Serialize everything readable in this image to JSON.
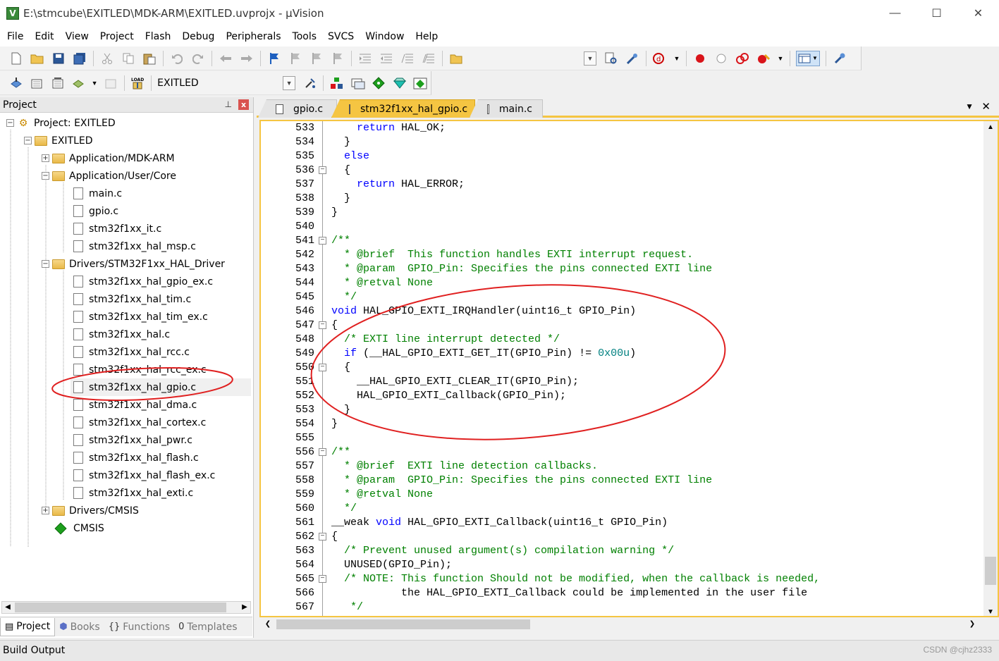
{
  "window": {
    "title": "E:\\stmcube\\EXITLED\\MDK-ARM\\EXITLED.uvprojx - µVision",
    "app_icon_letter": "V",
    "minimize": "—",
    "maximize": "☐",
    "close": "✕"
  },
  "menu": [
    "File",
    "Edit",
    "View",
    "Project",
    "Flash",
    "Debug",
    "Peripherals",
    "Tools",
    "SVCS",
    "Window",
    "Help"
  ],
  "toolbar2": {
    "target": "EXITLED"
  },
  "project_panel": {
    "title": "Project",
    "pin": "📌",
    "close": "x",
    "tree": {
      "root": "Project: EXITLED",
      "target": "EXITLED",
      "group_app_mdk": "Application/MDK-ARM",
      "group_app_core": "Application/User/Core",
      "core_files": [
        "main.c",
        "gpio.c",
        "stm32f1xx_it.c",
        "stm32f1xx_hal_msp.c"
      ],
      "group_hal": "Drivers/STM32F1xx_HAL_Driver",
      "hal_files": [
        "stm32f1xx_hal_gpio_ex.c",
        "stm32f1xx_hal_tim.c",
        "stm32f1xx_hal_tim_ex.c",
        "stm32f1xx_hal.c",
        "stm32f1xx_hal_rcc.c",
        "stm32f1xx_hal_rcc_ex.c",
        "stm32f1xx_hal_gpio.c",
        "stm32f1xx_hal_dma.c",
        "stm32f1xx_hal_cortex.c",
        "stm32f1xx_hal_pwr.c",
        "stm32f1xx_hal_flash.c",
        "stm32f1xx_hal_flash_ex.c",
        "stm32f1xx_hal_exti.c"
      ],
      "group_cmsis": "Drivers/CMSIS",
      "cmsis": "CMSIS"
    },
    "tabs": [
      "Project",
      "Books",
      "Functions",
      "Templates"
    ]
  },
  "editor": {
    "tabs": [
      "gpio.c",
      "stm32f1xx_hal_gpio.c",
      "main.c"
    ],
    "active_tab": "stm32f1xx_hal_gpio.c",
    "lines": [
      {
        "n": "533",
        "code": "    return HAL_OK;"
      },
      {
        "n": "534",
        "code": "  }"
      },
      {
        "n": "535",
        "code": "  else"
      },
      {
        "n": "536",
        "code": "  {"
      },
      {
        "n": "537",
        "code": "    return HAL_ERROR;"
      },
      {
        "n": "538",
        "code": "  }"
      },
      {
        "n": "539",
        "code": "}"
      },
      {
        "n": "540",
        "code": ""
      },
      {
        "n": "541",
        "code": "/**"
      },
      {
        "n": "542",
        "code": "  * @brief  This function handles EXTI interrupt request."
      },
      {
        "n": "543",
        "code": "  * @param  GPIO_Pin: Specifies the pins connected EXTI line"
      },
      {
        "n": "544",
        "code": "  * @retval None"
      },
      {
        "n": "545",
        "code": "  */"
      },
      {
        "n": "546",
        "code": "void HAL_GPIO_EXTI_IRQHandler(uint16_t GPIO_Pin)"
      },
      {
        "n": "547",
        "code": "{"
      },
      {
        "n": "548",
        "code": "  /* EXTI line interrupt detected */"
      },
      {
        "n": "549",
        "code": "  if (__HAL_GPIO_EXTI_GET_IT(GPIO_Pin) != 0x00u)"
      },
      {
        "n": "550",
        "code": "  {"
      },
      {
        "n": "551",
        "code": "    __HAL_GPIO_EXTI_CLEAR_IT(GPIO_Pin);"
      },
      {
        "n": "552",
        "code": "    HAL_GPIO_EXTI_Callback(GPIO_Pin);"
      },
      {
        "n": "553",
        "code": "  }"
      },
      {
        "n": "554",
        "code": "}"
      },
      {
        "n": "555",
        "code": ""
      },
      {
        "n": "556",
        "code": "/**"
      },
      {
        "n": "557",
        "code": "  * @brief  EXTI line detection callbacks."
      },
      {
        "n": "558",
        "code": "  * @param  GPIO_Pin: Specifies the pins connected EXTI line"
      },
      {
        "n": "559",
        "code": "  * @retval None"
      },
      {
        "n": "560",
        "code": "  */"
      },
      {
        "n": "561",
        "code": "__weak void HAL_GPIO_EXTI_Callback(uint16_t GPIO_Pin)"
      },
      {
        "n": "562",
        "code": "{"
      },
      {
        "n": "563",
        "code": "  /* Prevent unused argument(s) compilation warning */"
      },
      {
        "n": "564",
        "code": "  UNUSED(GPIO_Pin);"
      },
      {
        "n": "565",
        "code": "  /* NOTE: This function Should not be modified, when the callback is needed,"
      },
      {
        "n": "566",
        "code": "           the HAL_GPIO_EXTI_Callback could be implemented in the user file"
      },
      {
        "n": "567",
        "code": "   */"
      }
    ]
  },
  "build_output": {
    "label": "Build Output"
  },
  "watermark": "CSDN @cjhz2333",
  "colors": {
    "keyword": "#0000ff",
    "comment": "#008000",
    "number": "#008080",
    "active_tab": "#f5c542",
    "annotation": "#e02020"
  }
}
